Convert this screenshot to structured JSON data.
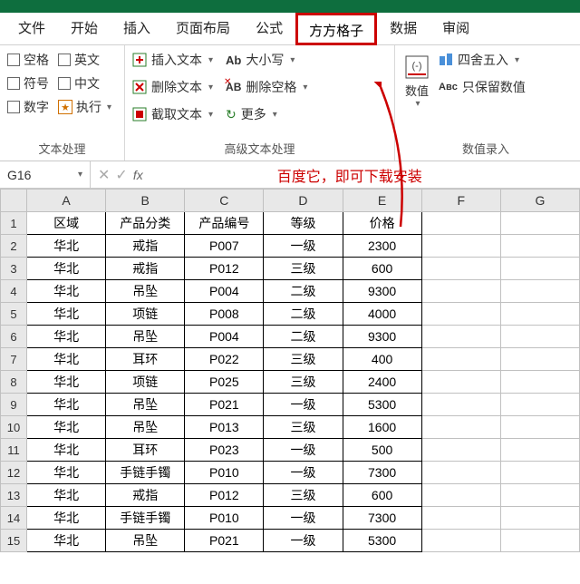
{
  "tabs": {
    "file": "文件",
    "home": "开始",
    "insert": "插入",
    "layout": "页面布局",
    "formula": "公式",
    "ffgz": "方方格子",
    "data": "数据",
    "review": "审阅"
  },
  "ribbon": {
    "group1_label": "文本处理",
    "group2_label": "高级文本处理",
    "group3_label": "数值录入",
    "chk_space": "空格",
    "chk_en": "英文",
    "chk_sym": "符号",
    "chk_cn": "中文",
    "chk_num": "数字",
    "chk_exec": "执行",
    "insert_text": "插入文本",
    "delete_text": "删除文本",
    "cut_text": "截取文本",
    "case": "大小写",
    "del_space": "删除空格",
    "more": "更多",
    "num_val": "数值",
    "round": "四舍五入",
    "keep_num": "只保留数值"
  },
  "namebox": "G16",
  "hint": "百度它，即可下载安装",
  "columns": [
    "A",
    "B",
    "C",
    "D",
    "E",
    "F",
    "G"
  ],
  "headers": [
    "区域",
    "产品分类",
    "产品编号",
    "等级",
    "价格"
  ],
  "rows": [
    [
      "华北",
      "戒指",
      "P007",
      "一级",
      "2300"
    ],
    [
      "华北",
      "戒指",
      "P012",
      "三级",
      "600"
    ],
    [
      "华北",
      "吊坠",
      "P004",
      "二级",
      "9300"
    ],
    [
      "华北",
      "项链",
      "P008",
      "二级",
      "4000"
    ],
    [
      "华北",
      "吊坠",
      "P004",
      "二级",
      "9300"
    ],
    [
      "华北",
      "耳环",
      "P022",
      "三级",
      "400"
    ],
    [
      "华北",
      "项链",
      "P025",
      "三级",
      "2400"
    ],
    [
      "华北",
      "吊坠",
      "P021",
      "一级",
      "5300"
    ],
    [
      "华北",
      "吊坠",
      "P013",
      "三级",
      "1600"
    ],
    [
      "华北",
      "耳环",
      "P023",
      "一级",
      "500"
    ],
    [
      "华北",
      "手链手镯",
      "P010",
      "一级",
      "7300"
    ],
    [
      "华北",
      "戒指",
      "P012",
      "三级",
      "600"
    ],
    [
      "华北",
      "手链手镯",
      "P010",
      "一级",
      "7300"
    ],
    [
      "华北",
      "吊坠",
      "P021",
      "一级",
      "5300"
    ]
  ]
}
